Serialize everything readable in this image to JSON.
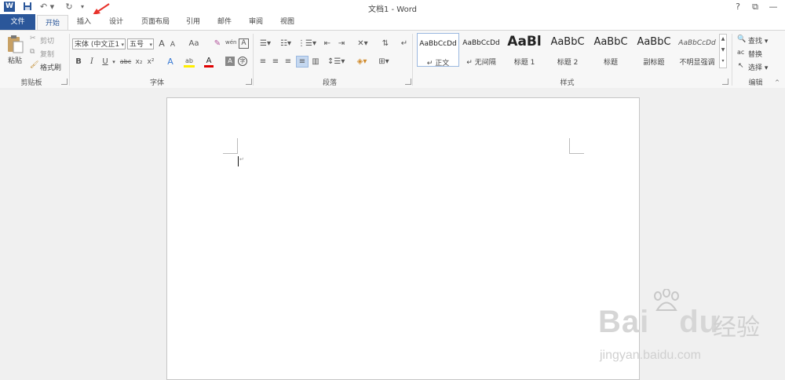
{
  "window": {
    "title": "文档1 - Word",
    "help": "?",
    "restore": "⧉",
    "minimize": "—"
  },
  "qat": {
    "save_icon": "save-icon",
    "undo_icon": "undo-icon",
    "redo_icon": "redo-icon"
  },
  "tabs": [
    {
      "label": "文件"
    },
    {
      "label": "开始"
    },
    {
      "label": "插入"
    },
    {
      "label": "设计"
    },
    {
      "label": "页面布局"
    },
    {
      "label": "引用"
    },
    {
      "label": "邮件"
    },
    {
      "label": "审阅"
    },
    {
      "label": "视图"
    }
  ],
  "clipboard": {
    "paste": "粘贴",
    "cut": "剪切",
    "copy": "复制",
    "format_painter": "格式刷",
    "group": "剪贴板"
  },
  "font": {
    "name": "宋体 (中文正1",
    "size": "五号",
    "grow": "A",
    "shrink": "A",
    "case": "Aa",
    "bold": "B",
    "italic": "I",
    "underline": "U",
    "strike": "abc",
    "sub": "x₂",
    "sup": "x²",
    "group": "字体"
  },
  "paragraph": {
    "group": "段落"
  },
  "styles": {
    "group": "样式",
    "items": [
      {
        "sample": "AaBbCcDd",
        "name": "↵ 正文"
      },
      {
        "sample": "AaBbCcDd",
        "name": "↵ 无间隔"
      },
      {
        "sample": "AaBl",
        "name": "标题 1"
      },
      {
        "sample": "AaBbC",
        "name": "标题 2"
      },
      {
        "sample": "AaBbC",
        "name": "标题"
      },
      {
        "sample": "AaBbC",
        "name": "副标题"
      },
      {
        "sample": "AaBbCcDd",
        "name": "不明显强调"
      }
    ]
  },
  "editing": {
    "find": "查找",
    "replace": "替换",
    "select": "选择",
    "group": "编辑"
  },
  "watermark": {
    "brand": "Bai",
    "brand2": "du",
    "cn": "经验",
    "url": "jingyan.baidu.com"
  },
  "colors": {
    "accent": "#2b579a",
    "arrow": "#e8322b"
  }
}
